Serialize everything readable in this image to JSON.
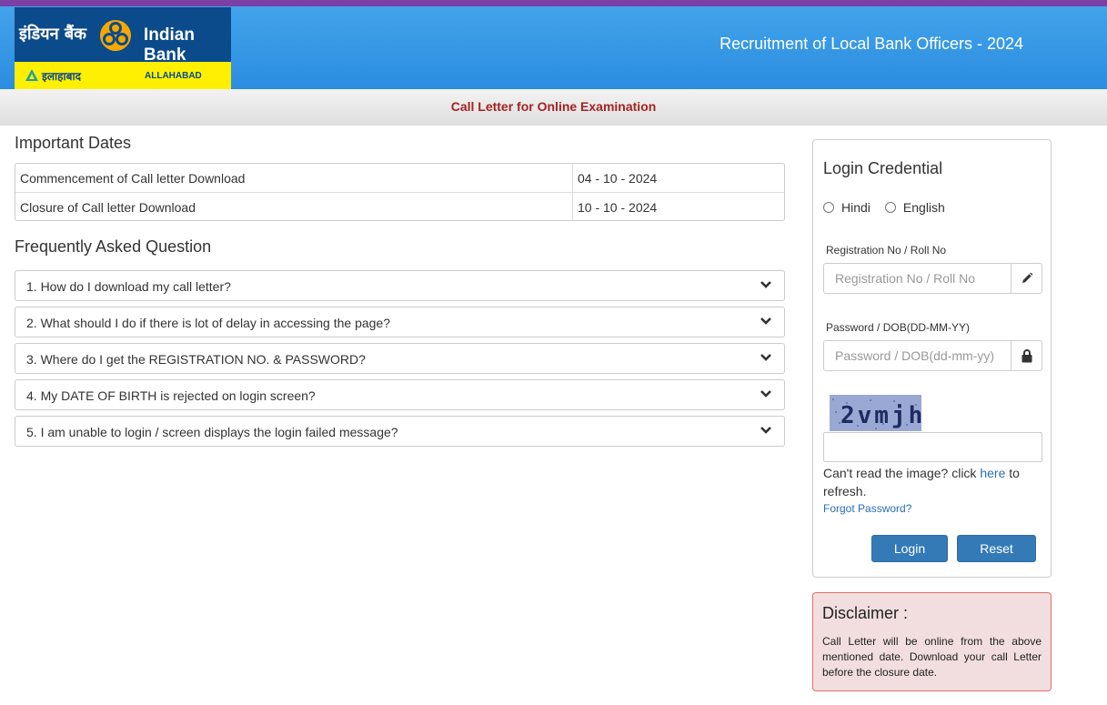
{
  "header": {
    "logo": {
      "hindi_name": "इंडियन बैंक",
      "english_name": "Indian Bank",
      "allahabad_hindi": "इलाहाबाद",
      "allahabad_english": "ALLAHABAD"
    },
    "title": "Recruitment of Local Bank Officers - 2024",
    "colors": {
      "header_blue": "#2a8de0",
      "top_strip": "#7b3fa5",
      "logo_navy": "#0b4a8b",
      "logo_yellow": "#ffef00"
    }
  },
  "subbar": {
    "title": "Call Letter for Online Examination",
    "color": "#a32323"
  },
  "important_dates": {
    "heading": "Important Dates",
    "rows": [
      {
        "label": "Commencement of Call letter Download",
        "value": "04 - 10 - 2024"
      },
      {
        "label": "Closure of Call letter Download",
        "value": "10 - 10 - 2024"
      }
    ]
  },
  "faq": {
    "heading": "Frequently Asked Question",
    "items": [
      {
        "question": "1. How do I download my call letter?",
        "icon": "chevron-down-icon"
      },
      {
        "question": "2. What should I do if there is lot of delay in accessing the page?",
        "icon": "chevron-down-icon"
      },
      {
        "question": "3. Where do I get the REGISTRATION NO. & PASSWORD?",
        "icon": "chevron-down-icon"
      },
      {
        "question": "4. My DATE OF BIRTH is rejected on login screen?",
        "icon": "chevron-down-icon"
      },
      {
        "question": "5. I am unable to login / screen displays the login failed message?",
        "icon": "chevron-down-icon"
      }
    ]
  },
  "login": {
    "title": "Login Credential",
    "languages": [
      "Hindi",
      "English"
    ],
    "registration": {
      "label": "Registration No / Roll No",
      "placeholder": "Registration No / Roll No",
      "value": "",
      "icon": "pencil-icon"
    },
    "password": {
      "label": "Password / DOB(DD-MM-YY)",
      "placeholder": "Password / DOB(dd-mm-yy)",
      "value": "",
      "icon": "lock-icon"
    },
    "captcha": {
      "text": "2vmjh",
      "input_value": ""
    },
    "refresh_prefix": "Can't read the image? click ",
    "refresh_link": "here",
    "refresh_suffix": " to refresh.",
    "forgot_password": "Forgot Password?",
    "login_button": "Login",
    "reset_button": "Reset",
    "button_color": "#337ab7"
  },
  "disclaimer": {
    "title": "Disclaimer :",
    "text": "Call Letter will be online from the above mentioned date. Download your call Letter before the closure date.",
    "background": "#f2dede",
    "border": "#e46d6d"
  }
}
